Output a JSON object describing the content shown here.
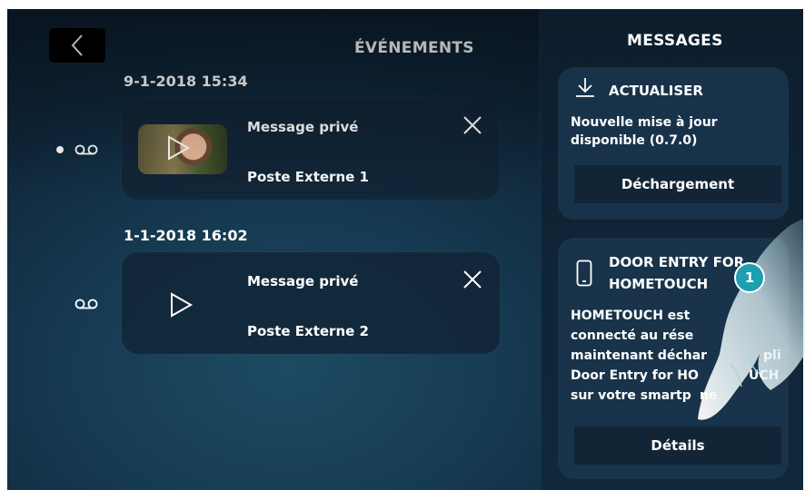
{
  "header": {
    "events_title": "ÉVÉNEMENTS",
    "messages_title": "MESSAGES"
  },
  "events": [
    {
      "date": "9-1-2018  15:34",
      "title": "Message privé",
      "source": "Poste Externe 1",
      "unread": true
    },
    {
      "date": "1-1-2018  16:02",
      "title": "Message privé",
      "source": "Poste Externe 2",
      "unread": false
    }
  ],
  "messages": {
    "update": {
      "title": "ACTUALISER",
      "body_line1": "Nouvelle mise à jour",
      "body_line2": "disponible (0.7.0)",
      "button": "Déchargement"
    },
    "app": {
      "title_line1": "DOOR ENTRY FOR",
      "title_line2": "HOMETOUCH",
      "body_line1": "HOMETOUCH est",
      "body_line2": "connecté au rése",
      "body_line3": "maintenant déchar",
      "body_line3b": "pli",
      "body_line4": "Door Entry for HO",
      "body_line4b": "UCH",
      "body_line5": "sur votre smartp",
      "body_line5b": "ne",
      "button": "Détails"
    }
  },
  "callout": {
    "number": "1"
  },
  "icons": [
    "back-arrow-icon",
    "close-icon",
    "play-icon",
    "voicemail-icon",
    "download-icon",
    "smartphone-icon",
    "hand-pointer-icon"
  ]
}
